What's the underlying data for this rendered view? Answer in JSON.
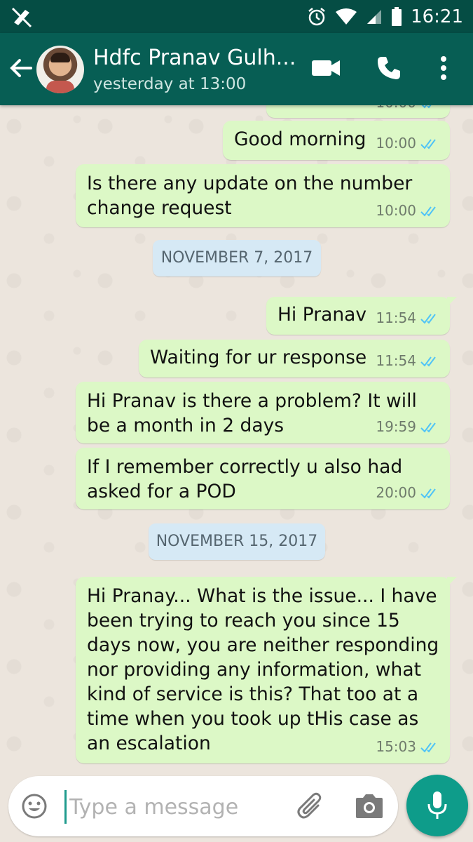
{
  "status_bar": {
    "time": "16:21"
  },
  "header": {
    "contact_name": "Hdfc Pranav Gulh...",
    "last_seen": "yesterday at 13:00",
    "icons": [
      "back-arrow-icon",
      "avatar",
      "video-call-icon",
      "phone-icon",
      "more-vert-icon"
    ]
  },
  "messages": [
    {
      "type": "out",
      "text": "",
      "time": "10:00",
      "status": "read"
    },
    {
      "type": "out",
      "text": "Good morning",
      "time": "10:00",
      "status": "read"
    },
    {
      "type": "out",
      "lines": [
        "Is there any update on the number",
        "change request"
      ],
      "time": "10:00",
      "status": "read"
    },
    {
      "type": "date",
      "text": "NOVEMBER 7, 2017"
    },
    {
      "type": "out",
      "text": "Hi Pranav",
      "time": "11:54",
      "status": "read"
    },
    {
      "type": "out",
      "text": "Waiting for ur response",
      "time": "11:54",
      "status": "read"
    },
    {
      "type": "out",
      "lines": [
        "Hi Pranav is there a problem? It will",
        "be a month in 2 days"
      ],
      "time": "19:59",
      "status": "read"
    },
    {
      "type": "out",
      "lines": [
        "If I remember correctly u also had",
        "asked for a POD"
      ],
      "time": "20:00",
      "status": "read"
    },
    {
      "type": "date",
      "text": "NOVEMBER 15, 2017"
    },
    {
      "type": "out",
      "lines": [
        "Hi Pranay... What is the issue... I have",
        "been trying to reach you since 15",
        "days now, you are neither responding",
        "nor providing any information, what",
        "kind of service is this? That too at a",
        "time when you took up tHis case as",
        "an escalation"
      ],
      "time": "15:03",
      "status": "read"
    }
  ],
  "composer": {
    "placeholder": "Type a message",
    "value": ""
  },
  "colors": {
    "header": "#075e54",
    "status_bar": "#054d44",
    "outgoing_bubble": "#dcf8c6",
    "date_chip": "#d6e9f5",
    "accent": "#0e9c8a",
    "read_ticks": "#4fc3f7"
  }
}
